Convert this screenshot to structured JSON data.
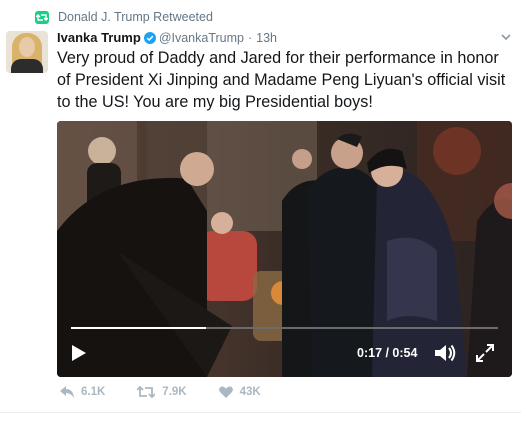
{
  "retweet": {
    "text": "Donald J. Trump Retweeted",
    "icon": "retweet-icon",
    "icon_color": "#19cf86"
  },
  "author": {
    "display_name": "Ivanka Trump",
    "handle": "@IvankaTrump",
    "separator": "·",
    "time": "13h",
    "verified_color": "#1da1f2"
  },
  "tweet": {
    "text": "Very proud of Daddy and Jared for their performance in honor of President Xi Jinping and Madame Peng Liyuan's official visit to the US! You are my big Presidential boys!"
  },
  "video": {
    "timecode": "0:17 / 0:54",
    "progress_fraction": 0.315
  },
  "actions": {
    "reply_count": "6.1K",
    "retweet_count": "7.9K",
    "like_count": "43K"
  }
}
